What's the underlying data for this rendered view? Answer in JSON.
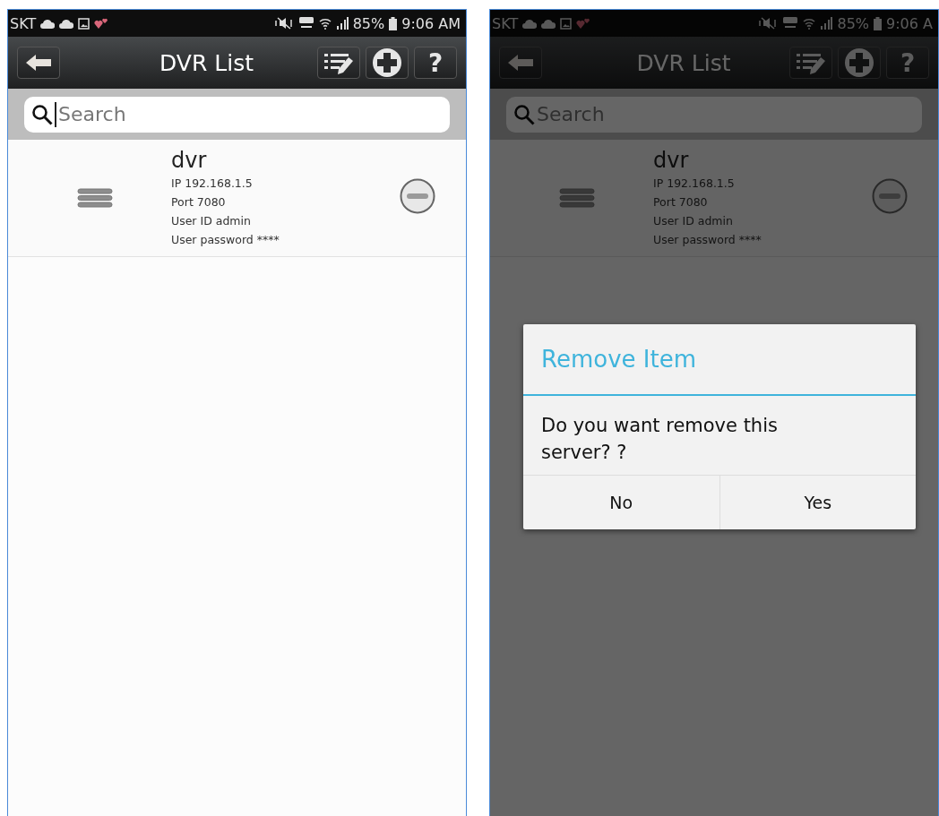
{
  "screens": [
    {
      "status_bar": {
        "carrier": "SKT",
        "battery": "85%",
        "time": "9:06 AM"
      },
      "app_bar": {
        "title": "DVR List",
        "help_label": "?"
      },
      "search": {
        "placeholder": "Search",
        "focused": true
      },
      "devices": [
        {
          "name": "dvr",
          "details": [
            "IP 192.168.1.5",
            "Port 7080",
            "User ID admin",
            "User password ****"
          ]
        }
      ]
    },
    {
      "status_bar": {
        "carrier": "SKT",
        "battery": "85%",
        "time": "9:06 A"
      },
      "app_bar": {
        "title": "DVR List",
        "help_label": "?"
      },
      "search": {
        "placeholder": "Search",
        "focused": false
      },
      "devices": [
        {
          "name": "dvr",
          "details": [
            "IP 192.168.1.5",
            "Port 7080",
            "User ID admin",
            "User password ****"
          ]
        }
      ],
      "dialog": {
        "title": "Remove Item",
        "message": "Do you want remove this server? ?",
        "buttons": [
          "No",
          "Yes"
        ]
      }
    }
  ]
}
